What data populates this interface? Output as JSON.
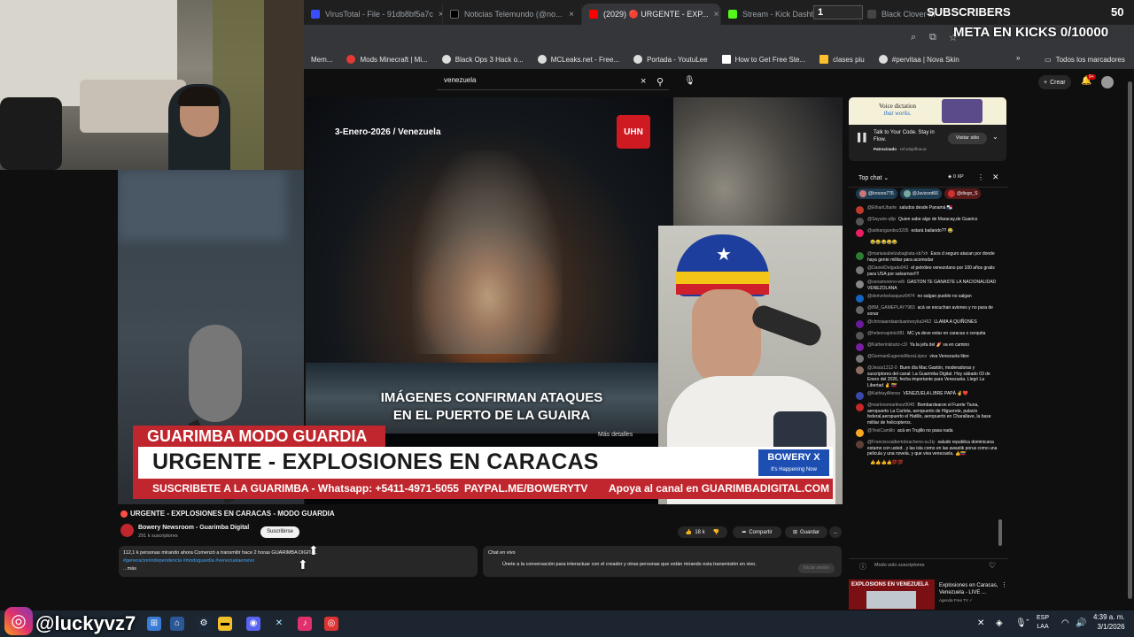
{
  "browser": {
    "tabs": [
      {
        "label": "VirusTotal - File - 91db8bf5a7c",
        "color": "#394eff",
        "active": false
      },
      {
        "label": "Noticias Telemundo (@no...",
        "color": "#000000",
        "active": false
      },
      {
        "label": "(2029) 🔴 URGENTE - EXP...",
        "color": "#ff0000",
        "active": true
      },
      {
        "label": "Stream - Kick Dashboard",
        "color": "#53fc18",
        "active": false
      },
      {
        "label": "Black Clover M",
        "color": "#444444",
        "active": false
      }
    ],
    "tab_close": "×",
    "progress_tab_number": "1",
    "bookmarks": [
      {
        "label": "Mem..."
      },
      {
        "label": "Mods Minecraft | Mi..."
      },
      {
        "label": "Black Ops 3 Hack o..."
      },
      {
        "label": "MCLeaks.net - Free..."
      },
      {
        "label": "Portada - YoutuLee"
      },
      {
        "label": "How to Get Free Ste..."
      },
      {
        "label": "clases piu"
      },
      {
        "label": "#pervitaa | Nova Skin"
      }
    ],
    "bookmarks_more": "»",
    "bookmarks_folder": "Todos los marcadores"
  },
  "overlay": {
    "subscribers_label": "SUBSCRIBERS",
    "subscribers_count": "50",
    "meta_text": "META EN KICKS 0/10000",
    "instagram_handle": "@luckyvz7"
  },
  "youtube": {
    "search_value": "venezuela",
    "search_clear": "×",
    "create_label": "Crear",
    "bell_badge": "9+"
  },
  "video": {
    "date_text": "3-Enero-2026 / Venezuela",
    "logo_text": "UHN",
    "caption_line1": "IMÁGENES CONFIRMAN ATAQUES",
    "caption_line2": "EN EL PUERTO DE LA GUAIRA",
    "mas_detalles": "Más detalles",
    "lower_third_top": "GUARIMBA MODO GUARDIA",
    "lower_third_main": "URGENTE - EXPLOSIONES EN CARACAS",
    "brand_name": "BOWERY X",
    "brand_tagline": "It's Happening Now",
    "ticker_1": "SUSCRIBETE A LA GUARIMBA - Whatsapp: +5411-4971-5055",
    "ticker_2": "PAYPAL.ME/BOWERYTV",
    "ticker_3": "Apoya al canal en GUARIMBADIGITAL.COM"
  },
  "info": {
    "title": "URGENTE - EXPLOSIONES EN CARACAS - MODO GUARDIA",
    "channel_name": "Bowery Newsroom - Guarimba Digital",
    "channel_subs": "291 k suscriptores",
    "subscribe_label": "Suscribirse",
    "likes": "18 k",
    "share_label": "Compartir",
    "save_label": "Guardar",
    "more_label": "...",
    "desc_line1": "112,1 k personas mirando ahora  Comenzó a transmitir hace 2 horas  GUARIMBA DIGITAL",
    "desc_tags": "#generacionindependencia #modoguardia #venezuelaenvivo",
    "desc_more": "...más",
    "chat_box_title": "Chat en vivo",
    "chat_box_text": "Únete a la conversación para interactuar con el creador y otras personas que están mirando esta transmisión en vivo.",
    "chat_box_btn": "Iniciar sesión"
  },
  "ad": {
    "banner_text_1": "Voice dictation",
    "banner_text_2": "that works.",
    "headline": "Talk to Your Code. Stay in Flow.",
    "sponsored": "Patrocinado",
    "domain": "ref.wisprflow.ai",
    "visit_label": "Visitar sitio"
  },
  "chat": {
    "title": "Top chat",
    "xp": "0 XP",
    "pinned": [
      "@kroooo776",
      "@Javicord66",
      "@diego_S"
    ],
    "messages": [
      {
        "name": "@EthanUbarte",
        "text": "saludos desde Panamá 🇵🇦",
        "color": "#c0392b"
      },
      {
        "name": "@Sayurie-q9p",
        "text": "Quien sabe algo de Maracay,de Guarico",
        "color": "#555555"
      },
      {
        "name": "@adriangundez3205",
        "text": "estará bailando?? 😂",
        "color": "#e91e63"
      },
      {
        "name": "",
        "text": "😂😂😂😂😂",
        "color": "#0f0f0f"
      },
      {
        "name": "@mariaisabelzabagliata-sb7xh",
        "text": "Esos d seguro atacan por donde haya gente militar para acomodar",
        "color": "#2e7d32"
      },
      {
        "name": "@DanielDelgado043",
        "text": "el petróleo venezolano por 100 años gratis para USA por salvarnos!!!!",
        "color": "#777777"
      },
      {
        "name": "@osnamoreno-w8i",
        "text": "GASTON TE GANASTE LA NACIONALIDAD VENEZOLANA",
        "color": "#888888"
      },
      {
        "name": "@derivelvelasquez6474",
        "text": "no salgan pueblo no salgan",
        "color": "#1565c0"
      },
      {
        "name": "@BM_GAMEPLAY7983",
        "text": "acá se escuchan aviones y no para de sonar",
        "color": "#666666"
      },
      {
        "name": "@chrisiaandaarduaniwsyka3462",
        "text": "LLAMA A QUIÑONES",
        "color": "#6a1b9a"
      },
      {
        "name": "@heleonapinto081",
        "text": "MC ya deve estar en caracas o cerquita",
        "color": "#555555"
      },
      {
        "name": "@Katherinlsturiz-c3l",
        "text": "Ya la jefa del 🍠 va en camino",
        "color": "#7b1fa2"
      },
      {
        "name": "@GermanEugenioMezaLópez",
        "text": "viva Venezuela libre",
        "color": "#777777"
      },
      {
        "name": "@Jesús1312-0",
        "text": "Buen día Mac Gastón, moderadoras y suscriptores del canal: La Guarimba Digital. Hoy sábado 03 de Enero del 2026, fecha importante para Venezuela. Llegó La Libertad ✌️ 🇻🇪",
        "color": "#8d6e63"
      },
      {
        "name": "@KathiuyAfonso",
        "text": "VENEZUELA LIBRE PAPÁ ✌️❤️",
        "color": "#3949ab"
      },
      {
        "name": "@marlonomartinez9045",
        "text": "Bombardearon el Fuerte Tiuna, aeropuerto La Carlota, aeropuerto de Higuerote, palacio federal,aeropuerto el Hatillo, aeropuerto en Charallave, la base militar de helicopteros.",
        "color": "#c62828"
      },
      {
        "name": "@YesiCamillo",
        "text": "acá en Trujillo no pasa nada",
        "color": "#f9a825"
      },
      {
        "name": "@Franciscoalbertobracheno-su1ty",
        "text": "saludo republica dominicana estamo con usted . y las isla como en las awastik porus como una pelicula y una novela. y que viva venezuela. 👍🇻🇪",
        "color": "#5d4037"
      },
      {
        "name": "",
        "text": "👍👍👍👍💯💯",
        "color": "#0f0f0f"
      }
    ],
    "footer": "Modo solo suscriptores"
  },
  "related": {
    "thumb_label": "EXPLOSIONS EN VENEZUELA",
    "title": "Explosiones en Caracas, Venezuela - LIVE ...",
    "channel": "Agenda Free TV ✓"
  },
  "taskbar": {
    "lang_1": "ESP",
    "lang_2": "LAA",
    "time": "4:39 a. m.",
    "date": "3/1/2026"
  }
}
